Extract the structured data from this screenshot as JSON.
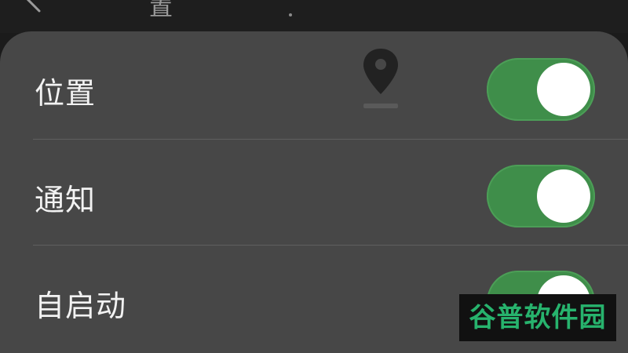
{
  "header": {
    "title": "置"
  },
  "settings": {
    "items": [
      {
        "label": "位置",
        "enabled": true
      },
      {
        "label": "通知",
        "enabled": true
      },
      {
        "label": "自启动",
        "enabled": true
      }
    ]
  },
  "icons": {
    "back": "back-arrow-icon",
    "location": "location-pin-icon"
  },
  "colors": {
    "toggle_on": "#3f8e4a",
    "sheet_background": "#474747",
    "watermark_text": "#27b36d"
  },
  "watermark": {
    "text": "谷普软件园"
  }
}
